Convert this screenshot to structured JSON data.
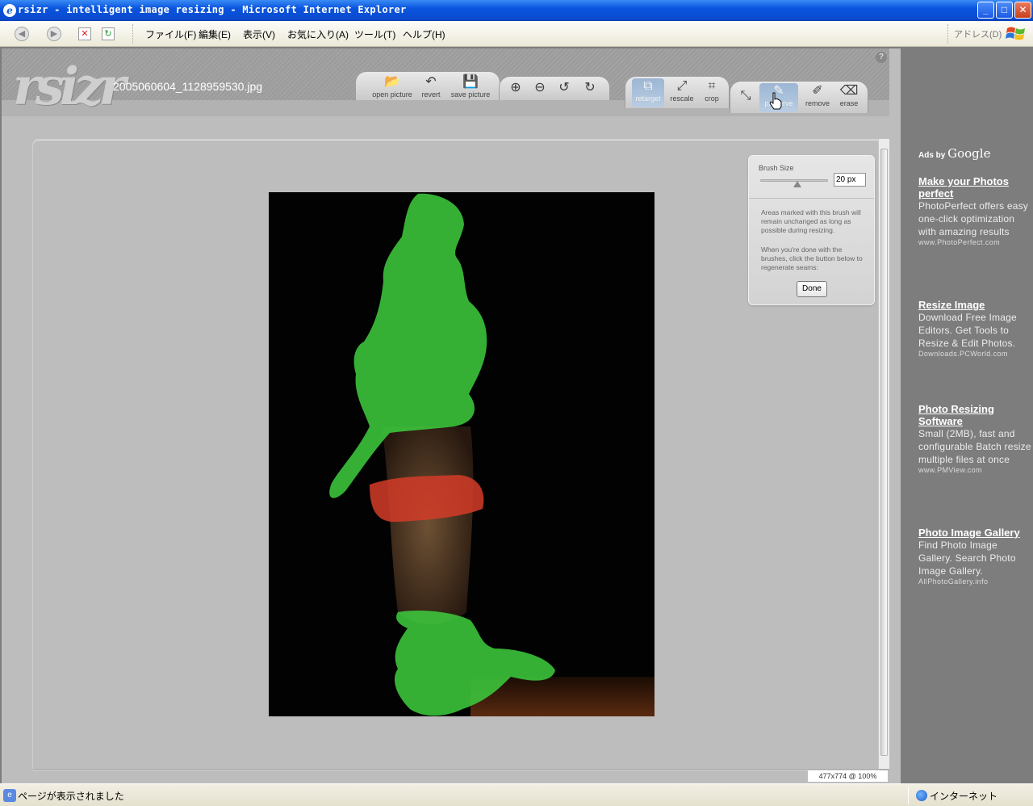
{
  "window": {
    "title": "rsizr - intelligent image resizing - Microsoft Internet Explorer",
    "controls": {
      "minimize": "_",
      "maximize": "□",
      "close": "✕"
    }
  },
  "menubar": {
    "back_glyph": "◀",
    "forward_glyph": "▶",
    "stop_glyph": "✕",
    "refresh_glyph": "↻",
    "items": [
      "ファイル(F)",
      "編集(E)",
      "表示(V)",
      "お気に入り(A)",
      "ツール(T)",
      "ヘルプ(H)"
    ],
    "address_label": "アドレス(D)"
  },
  "app": {
    "logo": "rsizr",
    "filename": "2005060604_1128959530.jpg",
    "help": "?",
    "file_tools": [
      {
        "label": "open picture",
        "icon": "folder-icon",
        "glyph": "📂"
      },
      {
        "label": "revert",
        "icon": "undo-arrow-icon",
        "glyph": "↶"
      },
      {
        "label": "save picture",
        "icon": "disk-icon",
        "glyph": "💾"
      }
    ],
    "view_tools": [
      {
        "icon": "zoom-in-icon",
        "glyph": "⊕"
      },
      {
        "icon": "zoom-out-icon",
        "glyph": "⊖"
      },
      {
        "icon": "rotate-left-icon",
        "glyph": "↺"
      },
      {
        "icon": "rotate-right-icon",
        "glyph": "↻"
      }
    ],
    "mode_tools": [
      {
        "label": "retarget",
        "icon": "retarget-icon",
        "glyph": "⧉",
        "active": true
      },
      {
        "label": "rescale",
        "icon": "rescale-icon",
        "glyph": "⤢"
      },
      {
        "label": "crop",
        "icon": "crop-icon",
        "glyph": "⌗"
      }
    ],
    "brush_tools": [
      {
        "label": "",
        "icon": "resize-arrows-icon",
        "glyph": "⤡"
      },
      {
        "label": "preserve",
        "icon": "preserve-brush-icon",
        "glyph": "✎",
        "active": true
      },
      {
        "label": "remove",
        "icon": "remove-brush-icon",
        "glyph": "✐"
      },
      {
        "label": "erase",
        "icon": "eraser-icon",
        "glyph": "⌫"
      }
    ],
    "status": "477x774 @ 100%"
  },
  "brush_panel": {
    "label": "Brush Size",
    "size_value": "20 px",
    "slider_level": 0.55,
    "desc1": "Areas marked with this brush will remain unchanged as long as possible during resizing.",
    "desc2": "When you're done with the brushes, click the button below to regenerate seams:",
    "done_label": "Done"
  },
  "ads": {
    "header_prefix": "Ads by",
    "header_brand": "Google",
    "items": [
      {
        "title": "Make your Photos perfect",
        "body": "PhotoPerfect offers easy one-click optimization with amazing results",
        "url": "www.PhotoPerfect.com"
      },
      {
        "title": "Resize Image",
        "body": "Download Free Image Editors. Get Tools to Resize & Edit Photos.",
        "url": "Downloads.PCWorld.com"
      },
      {
        "title": "Photo Resizing Software",
        "body": "Small (2MB), fast and configurable Batch resize multiple files at once",
        "url": "www.PMView.com"
      },
      {
        "title": "Photo Image Gallery",
        "body": "Find Photo Image Gallery. Search Photo Image Gallery.",
        "url": "AllPhotoGallery.info"
      }
    ]
  },
  "statusbar": {
    "text": "ページが表示されました",
    "zone": "インターネット"
  },
  "colors": {
    "preserve_mask": "#3cc83c",
    "remove_mask": "#d43c28"
  }
}
